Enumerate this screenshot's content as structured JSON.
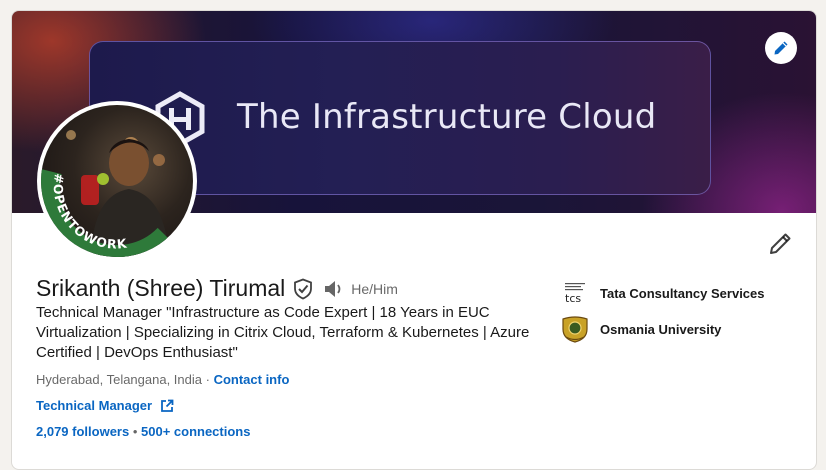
{
  "banner": {
    "title": "The Infrastructure Cloud",
    "edit_label": "Edit background",
    "logo_icon": "infrastructure-cloud-logo"
  },
  "avatar": {
    "badge_text": "#OPENTOWORK",
    "badge_color": "#2e7a3a"
  },
  "profile": {
    "name": "Srikanth (Shree) Tirumal",
    "verified_icon": "verified-shield-icon",
    "pronunciation_icon": "speaker-icon",
    "pronouns": "He/Him",
    "headline": "Technical Manager \"Infrastructure as Code Expert | 18 Years in EUC Virtualization | Specializing in Citrix Cloud, Terraform & Kubernetes | Azure Certified | DevOps Enthusiast\"",
    "location": "Hyderabad, Telangana, India",
    "location_separator": " · ",
    "contact_info": "Contact info",
    "job_link": "Technical Manager",
    "followers": "2,079 followers",
    "stats_separator": " • ",
    "connections": "500+ connections",
    "edit_icon": "pencil-icon"
  },
  "orgs": [
    {
      "name": "Tata Consultancy Services",
      "logo_text": "tcs",
      "logo_icon": "tcs-logo"
    },
    {
      "name": "Osmania University",
      "logo_icon": "osmania-university-crest"
    }
  ],
  "colors": {
    "link": "#0a66c2",
    "banner_bg": "#17133a"
  }
}
